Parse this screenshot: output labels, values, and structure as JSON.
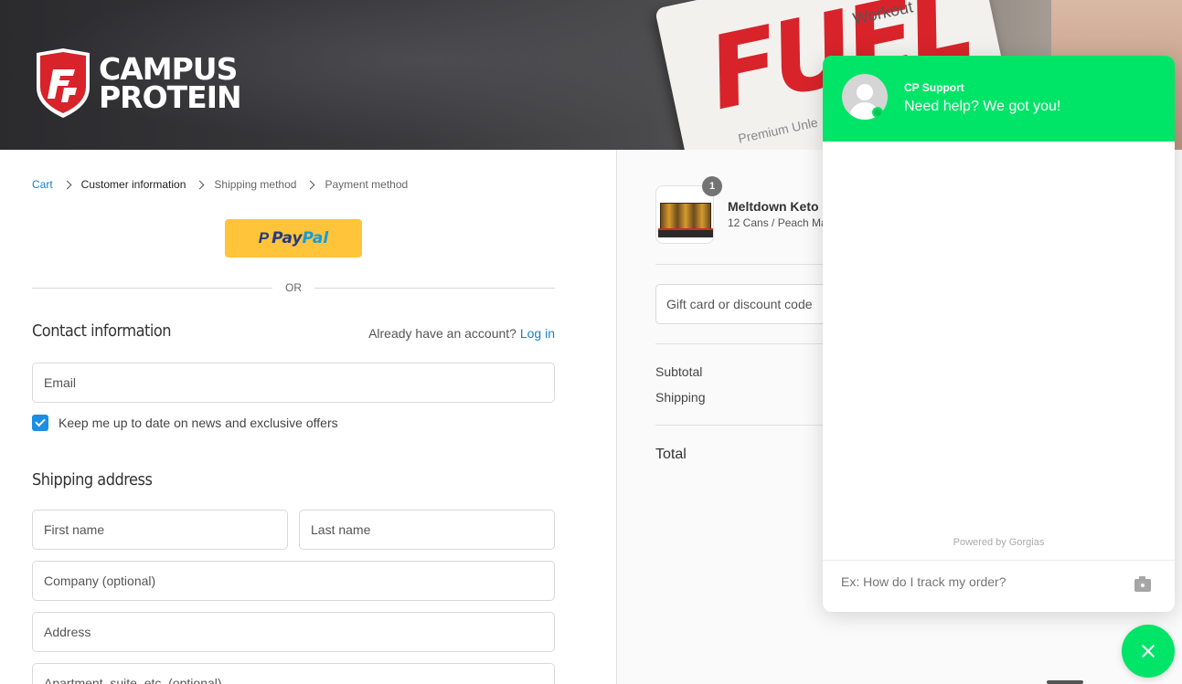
{
  "banner": {
    "logo_line1": "CAMPUS",
    "logo_line2": "PROTEIN",
    "can_text": "FUEL",
    "can_sub1": "Workout",
    "can_sub2": "Premium Unle"
  },
  "breadcrumb": {
    "cart": "Cart",
    "customer_info": "Customer information",
    "shipping": "Shipping method",
    "payment": "Payment method"
  },
  "paypal": {
    "label_part1": "Pay",
    "label_part2": "Pal",
    "mark": "P"
  },
  "divider_or": "OR",
  "contact": {
    "heading": "Contact information",
    "account_prompt": "Already have an account?",
    "login_link": "Log in",
    "email_placeholder": "Email",
    "newsletter_label": "Keep me up to date on news and exclusive offers",
    "newsletter_checked": true
  },
  "shipping": {
    "heading": "Shipping address",
    "first_name": "First name",
    "last_name": "Last name",
    "company": "Company (optional)",
    "address": "Address",
    "apartment": "Apartment, suite, etc. (optional)"
  },
  "order": {
    "quantity": "1",
    "product_name": "Meltdown Keto",
    "product_variant": "12 Cans / Peach Ma",
    "gift_placeholder": "Gift card or discount code",
    "subtotal_label": "Subtotal",
    "shipping_label": "Shipping",
    "total_label": "Total"
  },
  "chat": {
    "agent": "CP Support",
    "message": "Need help? We got you!",
    "powered_by": "Powered by Gorgias",
    "input_placeholder": "Ex: How do I track my order?",
    "accent_color": "#00e468"
  },
  "colors": {
    "link": "#1a7fcf",
    "paypal_yellow": "#ffc439",
    "logo_red": "#d8232a"
  }
}
